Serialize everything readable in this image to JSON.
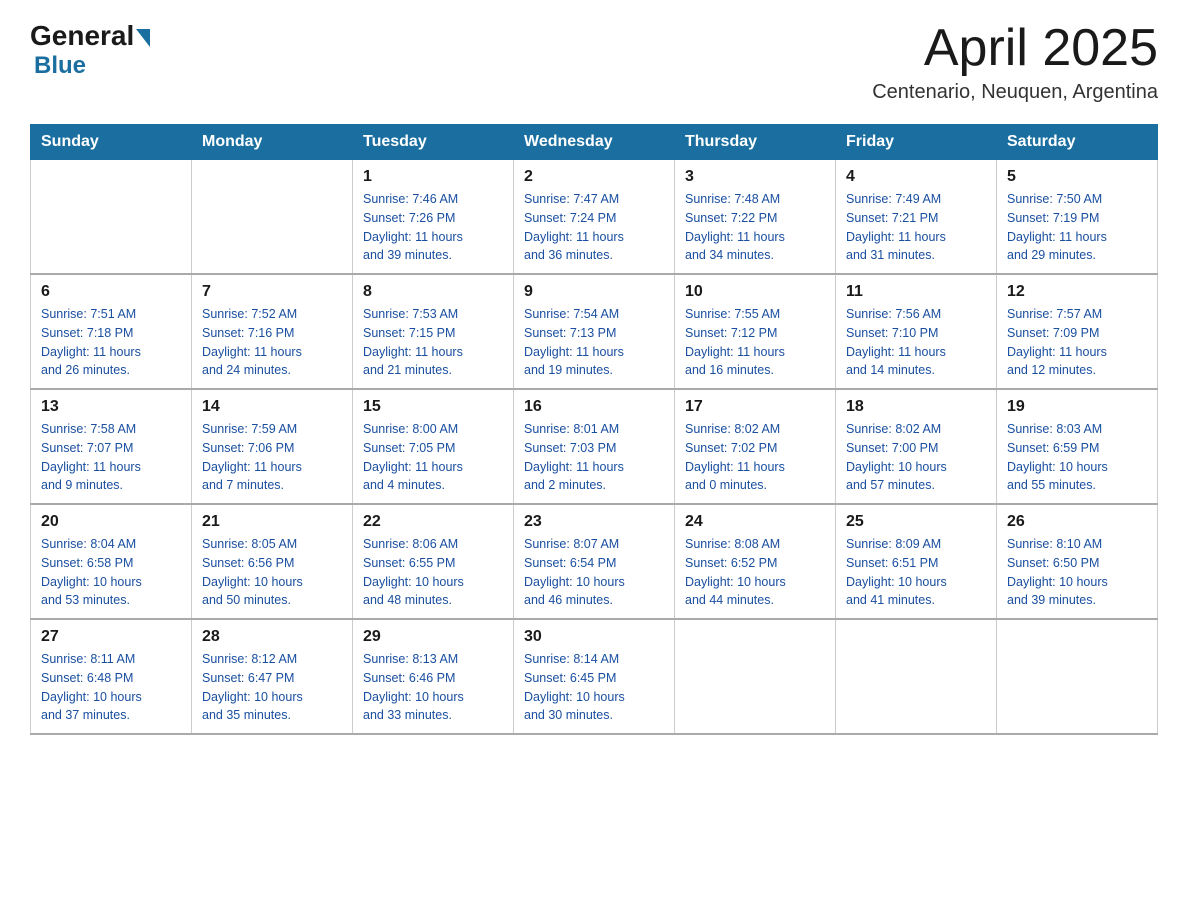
{
  "header": {
    "logo_general": "General",
    "logo_blue": "Blue",
    "title": "April 2025",
    "subtitle": "Centenario, Neuquen, Argentina"
  },
  "calendar": {
    "days_of_week": [
      "Sunday",
      "Monday",
      "Tuesday",
      "Wednesday",
      "Thursday",
      "Friday",
      "Saturday"
    ],
    "weeks": [
      [
        {
          "day": "",
          "info": ""
        },
        {
          "day": "",
          "info": ""
        },
        {
          "day": "1",
          "info": "Sunrise: 7:46 AM\nSunset: 7:26 PM\nDaylight: 11 hours\nand 39 minutes."
        },
        {
          "day": "2",
          "info": "Sunrise: 7:47 AM\nSunset: 7:24 PM\nDaylight: 11 hours\nand 36 minutes."
        },
        {
          "day": "3",
          "info": "Sunrise: 7:48 AM\nSunset: 7:22 PM\nDaylight: 11 hours\nand 34 minutes."
        },
        {
          "day": "4",
          "info": "Sunrise: 7:49 AM\nSunset: 7:21 PM\nDaylight: 11 hours\nand 31 minutes."
        },
        {
          "day": "5",
          "info": "Sunrise: 7:50 AM\nSunset: 7:19 PM\nDaylight: 11 hours\nand 29 minutes."
        }
      ],
      [
        {
          "day": "6",
          "info": "Sunrise: 7:51 AM\nSunset: 7:18 PM\nDaylight: 11 hours\nand 26 minutes."
        },
        {
          "day": "7",
          "info": "Sunrise: 7:52 AM\nSunset: 7:16 PM\nDaylight: 11 hours\nand 24 minutes."
        },
        {
          "day": "8",
          "info": "Sunrise: 7:53 AM\nSunset: 7:15 PM\nDaylight: 11 hours\nand 21 minutes."
        },
        {
          "day": "9",
          "info": "Sunrise: 7:54 AM\nSunset: 7:13 PM\nDaylight: 11 hours\nand 19 minutes."
        },
        {
          "day": "10",
          "info": "Sunrise: 7:55 AM\nSunset: 7:12 PM\nDaylight: 11 hours\nand 16 minutes."
        },
        {
          "day": "11",
          "info": "Sunrise: 7:56 AM\nSunset: 7:10 PM\nDaylight: 11 hours\nand 14 minutes."
        },
        {
          "day": "12",
          "info": "Sunrise: 7:57 AM\nSunset: 7:09 PM\nDaylight: 11 hours\nand 12 minutes."
        }
      ],
      [
        {
          "day": "13",
          "info": "Sunrise: 7:58 AM\nSunset: 7:07 PM\nDaylight: 11 hours\nand 9 minutes."
        },
        {
          "day": "14",
          "info": "Sunrise: 7:59 AM\nSunset: 7:06 PM\nDaylight: 11 hours\nand 7 minutes."
        },
        {
          "day": "15",
          "info": "Sunrise: 8:00 AM\nSunset: 7:05 PM\nDaylight: 11 hours\nand 4 minutes."
        },
        {
          "day": "16",
          "info": "Sunrise: 8:01 AM\nSunset: 7:03 PM\nDaylight: 11 hours\nand 2 minutes."
        },
        {
          "day": "17",
          "info": "Sunrise: 8:02 AM\nSunset: 7:02 PM\nDaylight: 11 hours\nand 0 minutes."
        },
        {
          "day": "18",
          "info": "Sunrise: 8:02 AM\nSunset: 7:00 PM\nDaylight: 10 hours\nand 57 minutes."
        },
        {
          "day": "19",
          "info": "Sunrise: 8:03 AM\nSunset: 6:59 PM\nDaylight: 10 hours\nand 55 minutes."
        }
      ],
      [
        {
          "day": "20",
          "info": "Sunrise: 8:04 AM\nSunset: 6:58 PM\nDaylight: 10 hours\nand 53 minutes."
        },
        {
          "day": "21",
          "info": "Sunrise: 8:05 AM\nSunset: 6:56 PM\nDaylight: 10 hours\nand 50 minutes."
        },
        {
          "day": "22",
          "info": "Sunrise: 8:06 AM\nSunset: 6:55 PM\nDaylight: 10 hours\nand 48 minutes."
        },
        {
          "day": "23",
          "info": "Sunrise: 8:07 AM\nSunset: 6:54 PM\nDaylight: 10 hours\nand 46 minutes."
        },
        {
          "day": "24",
          "info": "Sunrise: 8:08 AM\nSunset: 6:52 PM\nDaylight: 10 hours\nand 44 minutes."
        },
        {
          "day": "25",
          "info": "Sunrise: 8:09 AM\nSunset: 6:51 PM\nDaylight: 10 hours\nand 41 minutes."
        },
        {
          "day": "26",
          "info": "Sunrise: 8:10 AM\nSunset: 6:50 PM\nDaylight: 10 hours\nand 39 minutes."
        }
      ],
      [
        {
          "day": "27",
          "info": "Sunrise: 8:11 AM\nSunset: 6:48 PM\nDaylight: 10 hours\nand 37 minutes."
        },
        {
          "day": "28",
          "info": "Sunrise: 8:12 AM\nSunset: 6:47 PM\nDaylight: 10 hours\nand 35 minutes."
        },
        {
          "day": "29",
          "info": "Sunrise: 8:13 AM\nSunset: 6:46 PM\nDaylight: 10 hours\nand 33 minutes."
        },
        {
          "day": "30",
          "info": "Sunrise: 8:14 AM\nSunset: 6:45 PM\nDaylight: 10 hours\nand 30 minutes."
        },
        {
          "day": "",
          "info": ""
        },
        {
          "day": "",
          "info": ""
        },
        {
          "day": "",
          "info": ""
        }
      ]
    ]
  }
}
